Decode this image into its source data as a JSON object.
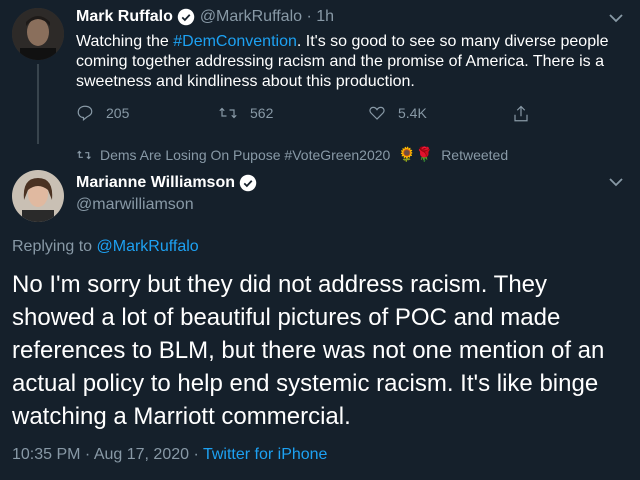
{
  "tweet1": {
    "name": "Mark Ruffalo",
    "handle": "@MarkRuffalo",
    "time": "· 1h",
    "text_before": "Watching the ",
    "hashtag": "#DemConvention",
    "text_after": ". It's so good to see so many diverse people coming together addressing racism and the promise of America. There is a sweetness and kindliness about this production.",
    "replies": "205",
    "retweets": "562",
    "likes": "5.4K"
  },
  "retweet_note": {
    "text": "Dems Are Losing On Pupose #VoteGreen2020",
    "emoji": "🌻🌹",
    "suffix": "Retweeted"
  },
  "tweet2": {
    "name": "Marianne Williamson",
    "handle": "@marwilliamson",
    "replying_prefix": "Replying to ",
    "replying_to": "@MarkRuffalo",
    "text": "No I'm sorry but they did not address racism. They showed a lot of beautiful pictures of POC and made references to BLM, but there was not one mention of an actual policy to help end systemic racism. It's like binge watching a Marriott commercial.",
    "timestamp": "10:35 PM · Aug 17, 2020 · ",
    "source": "Twitter for iPhone"
  },
  "colors": {
    "background": "#15202b",
    "accent": "#1da1f2",
    "muted": "#8899a6",
    "divider": "#38444d"
  }
}
